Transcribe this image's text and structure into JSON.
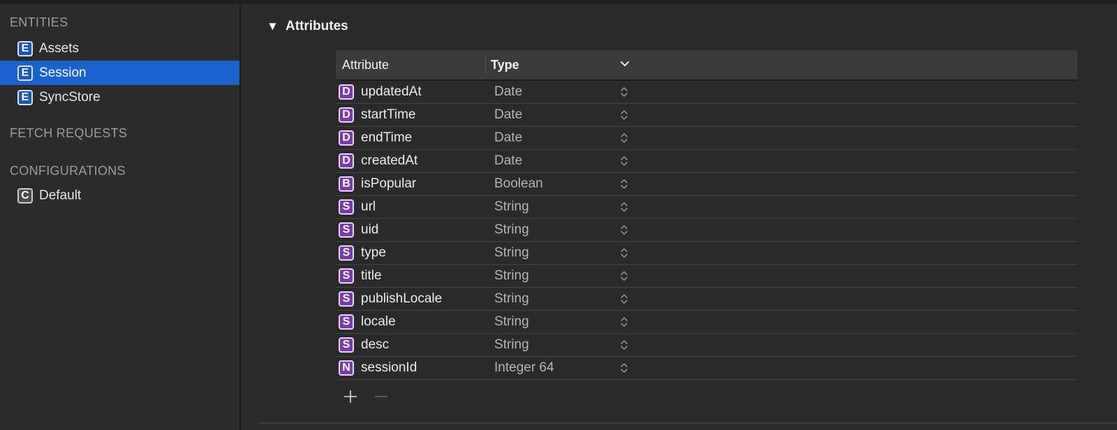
{
  "sidebar": {
    "entities_title": "ENTITIES",
    "entities": [
      {
        "badge": "E",
        "label": "Assets"
      },
      {
        "badge": "E",
        "label": "Session"
      },
      {
        "badge": "E",
        "label": "SyncStore"
      }
    ],
    "selected_entity": "Session",
    "fetch_requests_title": "FETCH REQUESTS",
    "configurations_title": "CONFIGURATIONS",
    "configurations": [
      {
        "badge": "C",
        "label": "Default"
      }
    ]
  },
  "main": {
    "disclosure_glyph": "▼",
    "section_title": "Attributes",
    "table": {
      "columns": {
        "attribute": "Attribute",
        "type": "Type"
      },
      "rows": [
        {
          "badge": "D",
          "name": "updatedAt",
          "type": "Date"
        },
        {
          "badge": "D",
          "name": "startTime",
          "type": "Date"
        },
        {
          "badge": "D",
          "name": "endTime",
          "type": "Date"
        },
        {
          "badge": "D",
          "name": "createdAt",
          "type": "Date"
        },
        {
          "badge": "B",
          "name": "isPopular",
          "type": "Boolean"
        },
        {
          "badge": "S",
          "name": "url",
          "type": "String"
        },
        {
          "badge": "S",
          "name": "uid",
          "type": "String"
        },
        {
          "badge": "S",
          "name": "type",
          "type": "String"
        },
        {
          "badge": "S",
          "name": "title",
          "type": "String"
        },
        {
          "badge": "S",
          "name": "publishLocale",
          "type": "String"
        },
        {
          "badge": "S",
          "name": "locale",
          "type": "String"
        },
        {
          "badge": "S",
          "name": "desc",
          "type": "String"
        },
        {
          "badge": "N",
          "name": "sessionId",
          "type": "Integer 64"
        }
      ]
    },
    "buttons": {
      "add": "add-icon",
      "remove": "remove-icon"
    }
  },
  "colors": {
    "selection": "#1c62cf",
    "entity_badge": "#1b57b8",
    "attribute_badge": "#7a3aae",
    "background": "#2a2a2a"
  }
}
